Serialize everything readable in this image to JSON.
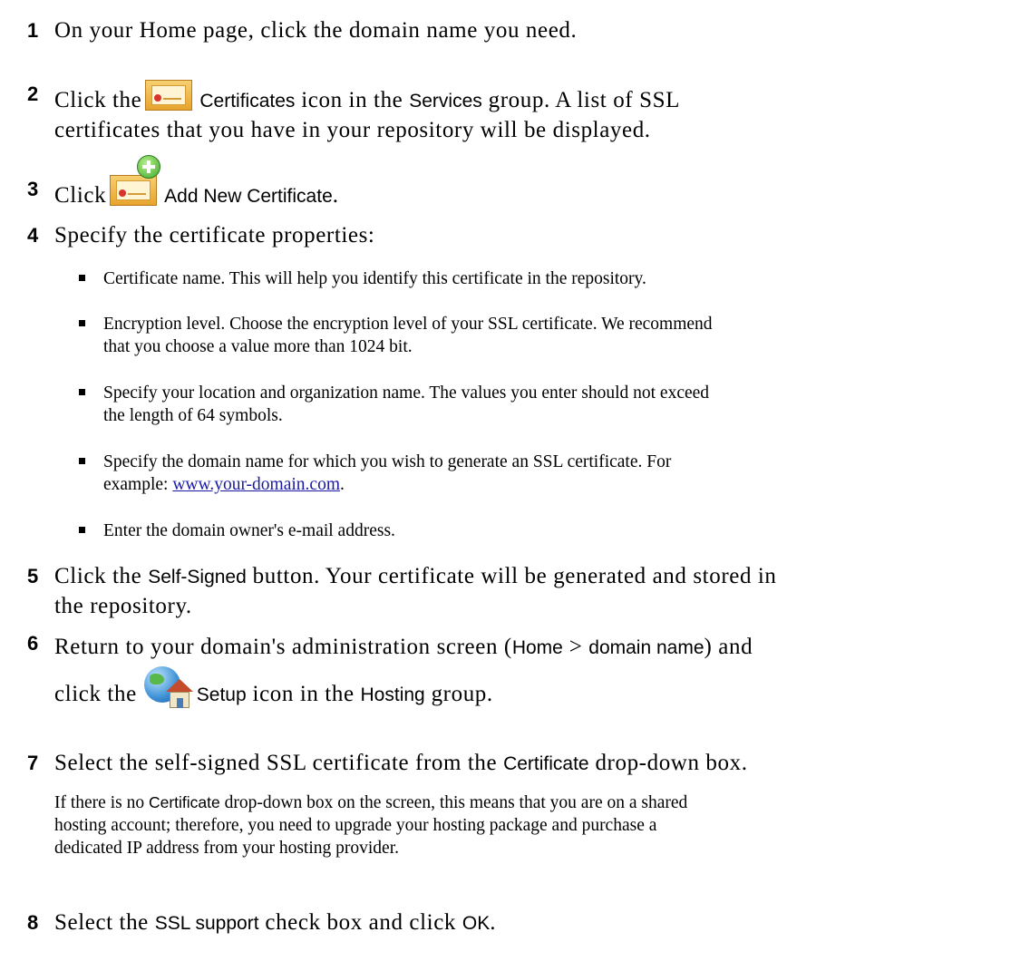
{
  "steps": [
    {
      "number": "1",
      "text": "On your Home page, click the domain name you need."
    },
    {
      "number": "2",
      "pre": "Click the",
      "icon": "certificate-icon",
      "ui_term": "Certificates",
      "mid": " icon in the ",
      "ui_term2": "Services",
      "post_line1": " group. A list of SSL",
      "line2": "certificates that you have in your repository will be displayed."
    },
    {
      "number": "3",
      "pre": "Click",
      "icon": "add-certificate-icon",
      "ui_term": "Add New Certificate",
      "post": "."
    },
    {
      "number": "4",
      "text": "Specify the certificate properties:",
      "bullets": [
        "Certificate name. This will help you identify this certificate in the repository.",
        "Encryption level. Choose the encryption level of your SSL certificate. We recommend",
        "that you choose a value more than 1024 bit.",
        "Specify your location and organization name. The values you enter should not exceed",
        "the length of 64 symbols.",
        "Specify the domain name for which you wish to generate an SSL certificate. For",
        "example: ",
        "www.your-domain.com",
        ".",
        "Enter the domain owner's e-mail address."
      ]
    },
    {
      "number": "5",
      "pre": "Click the ",
      "ui_term": "Self-Signed",
      "post_line1": " button. Your certificate will be generated and stored in",
      "line2": "the repository."
    },
    {
      "number": "6",
      "pre": "Return to your domain's administration screen (",
      "ui_term": "Home",
      "sep": " > ",
      "ui_term2": "domain name",
      "post_line1": ") and",
      "line2_pre": "click the",
      "icon": "setup-icon",
      "ui_term3": "Setup",
      "line2_mid": " icon in the ",
      "ui_term4": "Hosting",
      "line2_post": " group."
    },
    {
      "number": "7",
      "pre": "Select the self-signed SSL certificate from the ",
      "ui_term": "Certificate",
      "post": " drop-down box.",
      "note_pre": "If there is no ",
      "note_ui": "Certificate",
      "note_line1": " drop-down box on the screen, this means that you are on a shared",
      "note_line2": "hosting account; therefore, you need to upgrade your hosting package and purchase a",
      "note_line3": "dedicated IP address from your hosting provider."
    },
    {
      "number": "8",
      "pre": "Select the ",
      "ui_term": "SSL support",
      "mid": " check box and click ",
      "ui_term2": "OK",
      "post": "."
    }
  ],
  "colors": {
    "link": "#1a1aa6",
    "text": "#000000"
  }
}
